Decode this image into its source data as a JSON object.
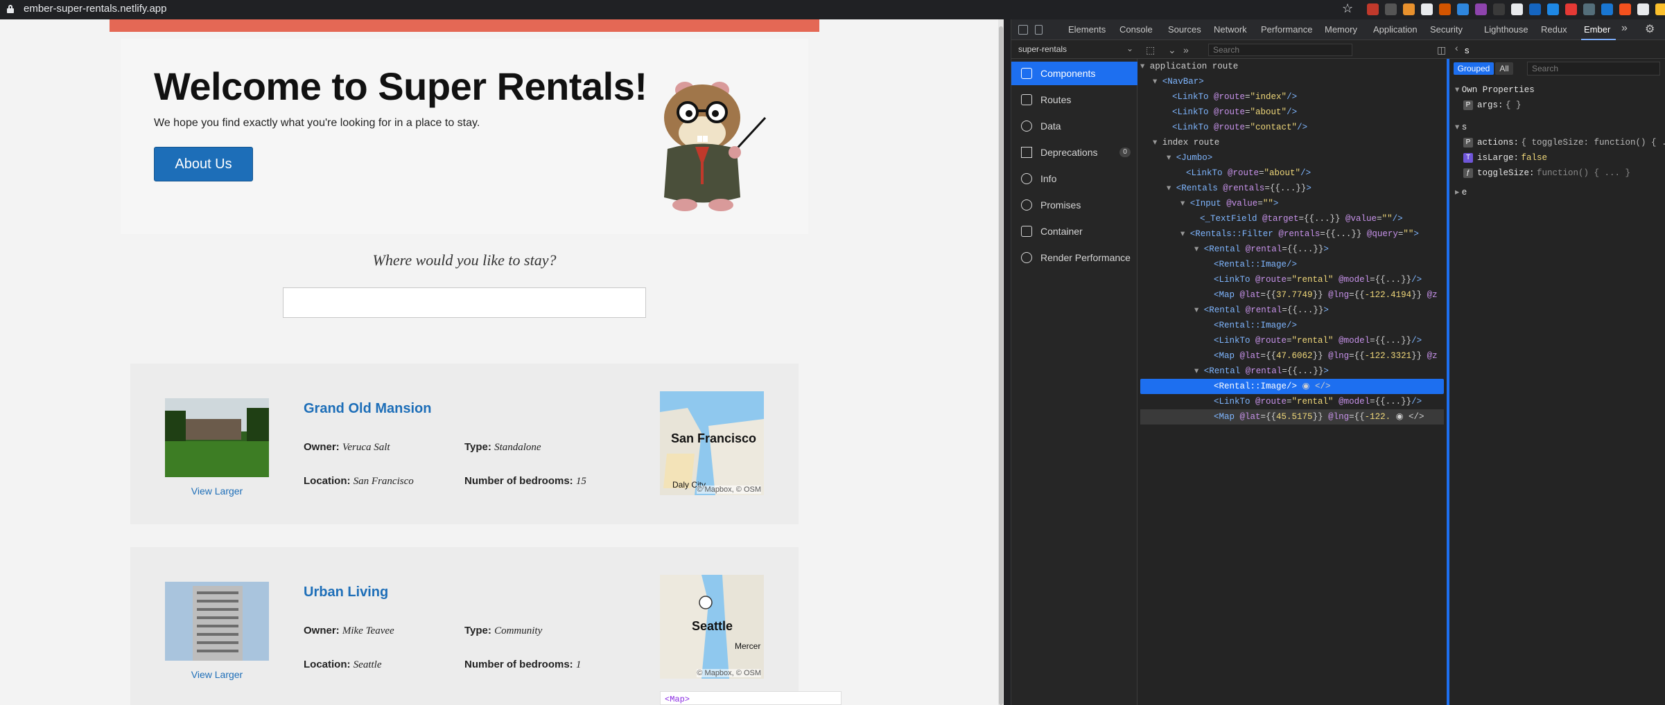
{
  "browser": {
    "url": "ember-super-rentals.netlify.app"
  },
  "page": {
    "jumbo": {
      "title": "Welcome to Super Rentals!",
      "text": "We hope you find exactly what you're looking for in a place to stay.",
      "button": "About Us"
    },
    "search": {
      "prompt": "Where would you like to stay?",
      "value": ""
    },
    "rentals": [
      {
        "title": "Grand Old Mansion",
        "owner_label": "Owner:",
        "owner": "Veruca Salt",
        "type_label": "Type:",
        "type": "Standalone",
        "location_label": "Location:",
        "location": "San Francisco",
        "bedrooms_label": "Number of bedrooms:",
        "bedrooms": "15",
        "view_larger": "View Larger",
        "map_city": "San Francisco",
        "map_sub": "Daly City",
        "map_attr": "© Mapbox, © OSM"
      },
      {
        "title": "Urban Living",
        "owner_label": "Owner:",
        "owner": "Mike Teavee",
        "type_label": "Type:",
        "type": "Community",
        "location_label": "Location:",
        "location": "Seattle",
        "bedrooms_label": "Number of bedrooms:",
        "bedrooms": "1",
        "view_larger": "View Larger",
        "map_city": "Seattle",
        "map_sub": "Mercer",
        "map_attr": "© Mapbox, © OSM"
      }
    ],
    "tooltip": "<Map>"
  },
  "devtools": {
    "tabs": [
      "Elements",
      "Console",
      "Sources",
      "Network",
      "Performance",
      "Memory",
      "Application",
      "Security",
      "Lighthouse",
      "Redux",
      "Ember"
    ],
    "overflow": "»",
    "app_select": "super-rentals",
    "search_placeholder": "Search",
    "nav": [
      {
        "label": "Components",
        "active": true
      },
      {
        "label": "Routes"
      },
      {
        "label": "Data"
      },
      {
        "label": "Deprecations",
        "badge": "0"
      },
      {
        "label": "Info"
      },
      {
        "label": "Promises"
      },
      {
        "label": "Container"
      },
      {
        "label": "Render Performance"
      }
    ],
    "inspector": {
      "title": "s",
      "grouped": "Grouped",
      "all": "All",
      "search_placeholder": "Search",
      "own_properties": "Own Properties",
      "args_key": "args:",
      "args_val": "{ }",
      "section_s": "s",
      "actions_key": "actions:",
      "actions_val": "{ toggleSize: function() { .",
      "islarge_key": "isLarge:",
      "islarge_val": "false",
      "togglesize_key": "toggleSize:",
      "togglesize_val": "function() { ... }",
      "section_e": "e"
    },
    "colors": {
      "accent": "#1d6ff0",
      "nav_red": "#e46855",
      "link_blue": "#1d6eb8"
    }
  }
}
